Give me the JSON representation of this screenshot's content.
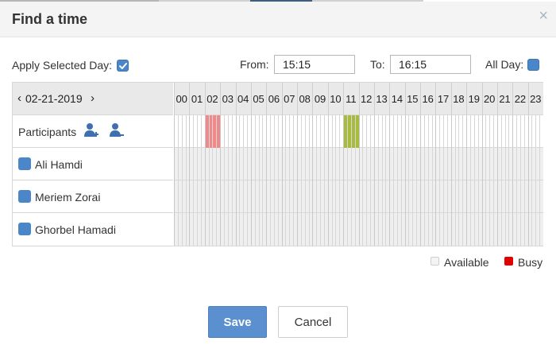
{
  "dialog": {
    "title": "Find a time",
    "close_glyph": "×"
  },
  "options": {
    "apply_selected_day_label": "Apply Selected Day:",
    "apply_selected_day_checked": true,
    "from_label": "From:",
    "from_value": "15:15",
    "to_label": "To:",
    "to_value": "16:15",
    "all_day_label": "All Day:",
    "all_day_checked": true
  },
  "scheduler": {
    "date": "02-21-2019",
    "prev_glyph": "‹",
    "next_glyph": "›",
    "participants_label": "Participants",
    "hours": [
      "00",
      "01",
      "02",
      "03",
      "04",
      "05",
      "06",
      "07",
      "08",
      "09",
      "10",
      "11",
      "12",
      "13",
      "14",
      "15",
      "16",
      "17",
      "18",
      "19",
      "20",
      "21",
      "22",
      "23"
    ],
    "participants": [
      {
        "name": "Ali Hamdi"
      },
      {
        "name": "Meriem Zorai"
      },
      {
        "name": "Ghorbel Hamadi"
      }
    ],
    "highlight_ranges": [
      {
        "start_hour": 2.0,
        "end_hour": 3.0,
        "color": "#f08a8a"
      },
      {
        "start_hour": 11.0,
        "end_hour": 12.0,
        "color": "#a8bb3e"
      }
    ]
  },
  "legend": {
    "available_label": "Available",
    "busy_label": "Busy",
    "busy_color": "#e00000"
  },
  "actions": {
    "save_label": "Save",
    "cancel_label": "Cancel"
  },
  "colors": {
    "accent": "#4a86c8",
    "save_button": "#5a8fd0"
  }
}
